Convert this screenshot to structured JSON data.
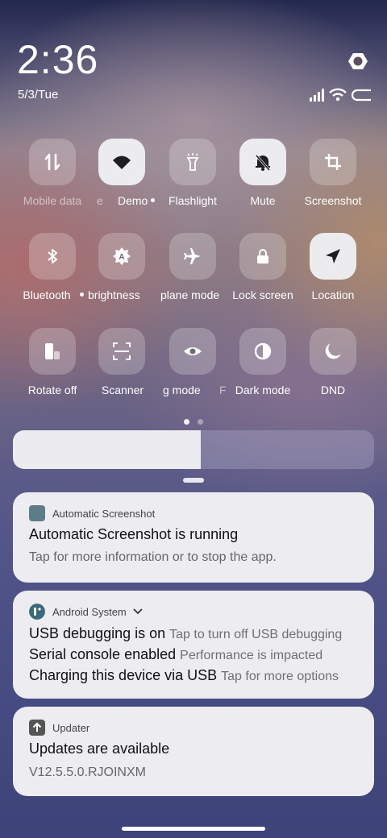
{
  "status": {
    "time": "2:36",
    "date": "5/3/Tue"
  },
  "quick_settings": {
    "rows": [
      [
        {
          "label": "Mobile data",
          "icon": "mobile-data-icon",
          "active": false,
          "label_dim": true
        },
        {
          "label": "e",
          "icon": "wifi-icon",
          "active": true,
          "label_dim": true
        },
        {
          "label": "Flashlight",
          "icon": "flashlight-icon",
          "active": false
        },
        {
          "label": "Mute",
          "icon": "mute-bell-icon",
          "active": true
        },
        {
          "label": "Screenshot",
          "icon": "crop-icon",
          "active": false
        }
      ],
      [
        {
          "label": "Bluetooth",
          "icon": "bluetooth-icon",
          "active": false
        },
        {
          "label": "brightness",
          "icon": "auto-brightness-icon",
          "active": false
        },
        {
          "label": "plane mode",
          "icon": "airplane-icon",
          "active": false
        },
        {
          "label": "Lock screen",
          "icon": "lock-icon",
          "active": false
        },
        {
          "label": "Location",
          "icon": "location-arrow-icon",
          "active": true
        }
      ],
      [
        {
          "label": "Rotate off",
          "icon": "rotate-lock-icon",
          "active": false
        },
        {
          "label": "Scanner",
          "icon": "scanner-icon",
          "active": false
        },
        {
          "label": "g mode",
          "icon": "eye-icon",
          "active": false
        },
        {
          "label": "Dark mode",
          "icon": "dark-mode-icon",
          "active": false
        },
        {
          "label": "DND",
          "icon": "moon-icon",
          "active": false
        }
      ]
    ],
    "wifi_label_tail": "Demo",
    "page_count": 2,
    "current_page": 1
  },
  "brightness": {
    "level": 0.52
  },
  "notifications": [
    {
      "app": "Automatic Screenshot",
      "icon": "screenshot-app-icon",
      "title": "Automatic Screenshot is running",
      "text": "Tap for more information or to stop the app."
    },
    {
      "app": "Android System",
      "icon": "android-system-icon",
      "lines": [
        {
          "title": "USB debugging is on",
          "text": "Tap to turn off USB debugging"
        },
        {
          "title": "Serial console enabled",
          "text": "Performance is impacted"
        },
        {
          "title": "Charging this device via USB",
          "text": "Tap for more options"
        }
      ]
    },
    {
      "app": "Updater",
      "icon": "upload-arrow-icon",
      "title": "Updates are available",
      "text": "V12.5.5.0.RJOINXM"
    }
  ],
  "colors": {
    "tile_active": "#f0f0f4",
    "card_bg": "#ededf1",
    "screenshot_icon": "#5d7c86",
    "android_icon": "#3a6a7a"
  }
}
